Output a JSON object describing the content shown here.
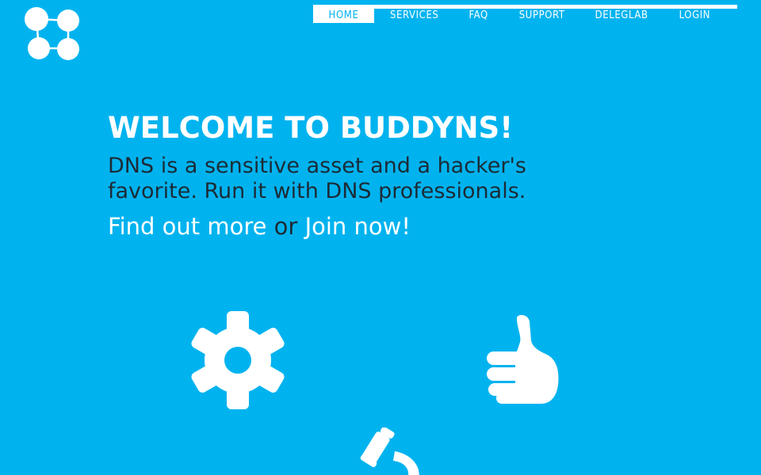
{
  "brand": {
    "logo_icon": "buddyns-logo-icon"
  },
  "nav": {
    "items": [
      {
        "label": "HOME",
        "active": true
      },
      {
        "label": "SERVICES",
        "active": false
      },
      {
        "label": "FAQ",
        "active": false
      },
      {
        "label": "SUPPORT",
        "active": false
      },
      {
        "label": "DELEGLAB",
        "active": false
      },
      {
        "label": "LOGIN",
        "active": false
      }
    ]
  },
  "hero": {
    "title": "WELCOME TO BUDDYNS!",
    "tagline_line1": "DNS is a sensitive asset and a hacker's",
    "tagline_line2": "favorite. Run it with DNS professionals.",
    "find_out_more": "Find out more",
    "or_text": " or ",
    "join_now": "Join now",
    "exclamation": "!"
  },
  "features": {
    "icons": [
      "gear-icon",
      "thumbs-up-icon",
      "microscope-icon"
    ]
  },
  "colors": {
    "background": "#00b3ef",
    "primary_text": "#ffffff",
    "secondary_text": "#1c2b36"
  }
}
